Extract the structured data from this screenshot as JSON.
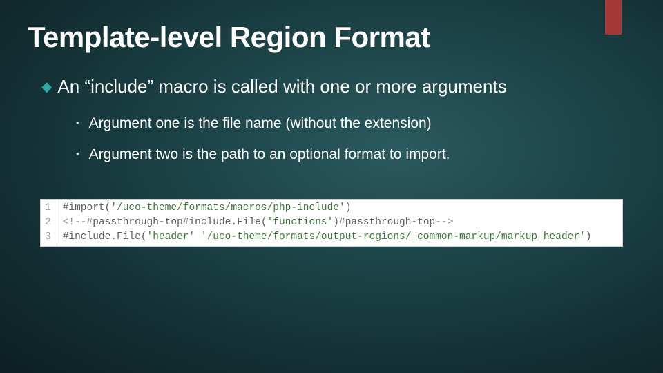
{
  "title": "Template-level Region Format",
  "bullets": {
    "main": "An “include” macro is called with one or more arguments",
    "sub1": "Argument one is the file name (without the extension)",
    "sub2": "Argument two is the path to an optional format to import."
  },
  "code": {
    "lineNumbers": [
      "1",
      "2",
      "3"
    ],
    "line1": {
      "a": "#import(",
      "b": "'/uco-theme/formats/macros/php-include'",
      "c": ")"
    },
    "line2": {
      "a": "<!--",
      "b": "#passthrough-top#",
      "c": "include.File(",
      "d": "'functions'",
      "e": ")",
      "f": "#passthrough-top",
      "g": "-->"
    },
    "line3": {
      "a": "#include.File(",
      "b": "'header'",
      "c": " ",
      "d": "'/uco-theme/formats/output-regions/_common-markup/markup_header'",
      "e": ")"
    }
  }
}
